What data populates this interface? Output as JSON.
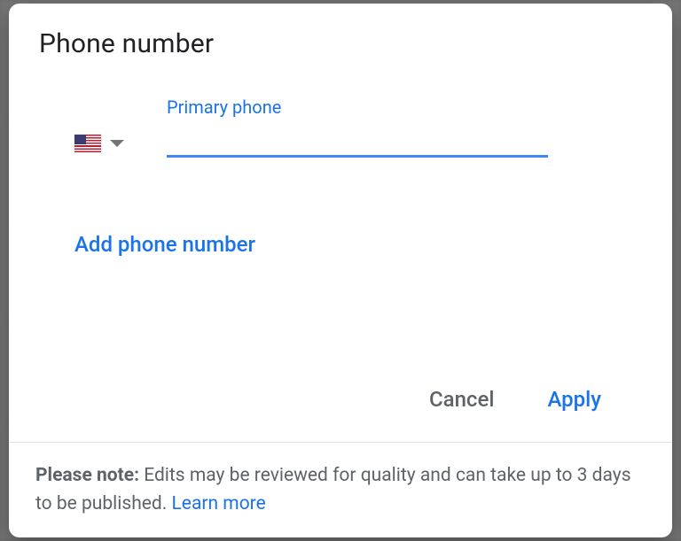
{
  "dialog": {
    "title": "Phone number",
    "primary_phone_label": "Primary phone",
    "phone_value": "",
    "add_phone_label": "Add phone number",
    "cancel_label": "Cancel",
    "apply_label": "Apply",
    "country": {
      "code": "US",
      "name": "United States"
    }
  },
  "footer": {
    "note_prefix": "Please note:",
    "note_body": " Edits may be reviewed for quality and can take up to 3 days to be published. ",
    "learn_more_label": "Learn more"
  },
  "colors": {
    "primary": "#1a73e8",
    "text": "#202124",
    "muted": "#5f6368"
  }
}
